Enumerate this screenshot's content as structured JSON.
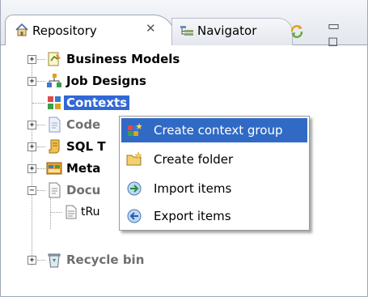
{
  "tabs": {
    "repository": {
      "label": "Repository",
      "close": "✕"
    },
    "navigator": {
      "label": "Navigator"
    },
    "window_controls": "▭ ◻"
  },
  "tree": {
    "items": [
      {
        "label": "Business Models",
        "expander": "+"
      },
      {
        "label": "Job Designs",
        "expander": "+"
      },
      {
        "label": "Contexts",
        "expander": "",
        "selected": true
      },
      {
        "label": "Code",
        "expander": "+",
        "muted": true
      },
      {
        "label": "SQL T",
        "expander": "+"
      },
      {
        "label": "Meta",
        "expander": "+"
      },
      {
        "label": "Docu",
        "expander": "−",
        "muted": true
      },
      {
        "label": "tRu",
        "expander": ""
      },
      {
        "label": "Recycle bin",
        "expander": "+",
        "muted": true
      }
    ]
  },
  "context_menu": {
    "items": [
      {
        "label": "Create context group",
        "icon": "context-group-icon",
        "highlighted": true
      },
      {
        "label": "Create folder",
        "icon": "folder-icon"
      },
      {
        "label": "Import items",
        "icon": "import-icon"
      },
      {
        "label": "Export items",
        "icon": "export-icon"
      }
    ]
  },
  "colors": {
    "selection": "#3168d5",
    "menu_highlight": "#316ac5",
    "border": "#9fa8b8"
  }
}
